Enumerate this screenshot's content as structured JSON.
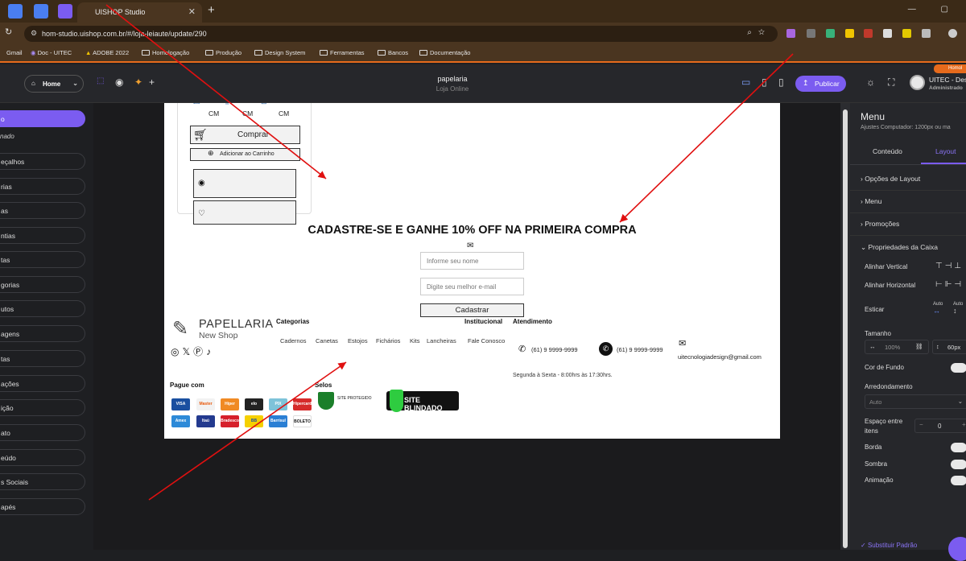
{
  "browser": {
    "tab_title": "UISHOP Studio",
    "tab_close": "✕",
    "new_tab": "+",
    "window_controls": "—  ▢",
    "url": "hom-studio.uishop.com.br/#/loja-leiaute/update/290",
    "bookmarks": [
      "Gmail",
      "Doc - UITEC",
      "ADOBE 2022",
      "Homologação",
      "Produção",
      "Design System",
      "Ferramentas",
      "Bancos",
      "Documentação"
    ]
  },
  "app_header": {
    "home_label": "Home",
    "project_name": "papelaria",
    "project_sub": "Loja Online",
    "publish_label": "Publicar",
    "user_name": "UITEC - Desi",
    "user_role": "Administrado",
    "env_tag": "Homol"
  },
  "sidebar": {
    "italic_label": "nado",
    "items": [
      "o",
      "eçalhos",
      "rias",
      "as",
      "ntias",
      "tas",
      "gorias",
      "utos",
      "agens",
      "tas",
      "ações",
      "ição",
      "ato",
      "eúdo",
      "s Sociais",
      "apés"
    ]
  },
  "page": {
    "sizes": [
      "CM",
      "CM",
      "CM"
    ],
    "buy_label": "Comprar",
    "add_cart_label": "Adicionar ao Carrinho",
    "newsletter_title": "CADASTRE-SE E GANHE 10% OFF NA PRIMEIRA COMPRA",
    "name_placeholder": "Informe seu nome",
    "email_placeholder": "Digite seu melhor e-mail",
    "submit_label": "Cadastrar",
    "logo_name": "PAPELLARIA",
    "logo_sub": "New Shop",
    "social_icons": "◎𝕏Ⓟ♪",
    "footer_categories_title": "Categorias",
    "footer_institutional_title": "Institucional",
    "footer_service_title": "Atendimento",
    "categories": [
      "Cadernos",
      "Canetas",
      "Estojos",
      "Fichários",
      "Kits",
      "Lancheiras",
      "Fale Conosco"
    ],
    "phone_1": "(61) 9 9999-9999",
    "phone_2": "(61) 9 9999-9999",
    "email": "uitecnologiadesign@gmail.com",
    "hours": "Segunda à Sexta - 8:00hrs às 17:30hrs.",
    "payment_title": "Pague com",
    "seals_title": "Selos",
    "payment_methods": [
      "VISA",
      "Master",
      "Hiper",
      "elo",
      "PIX",
      "Hipercard",
      "Amex",
      "Itaú",
      "Bradesco",
      "BB",
      "Barrisul",
      "BOLETO"
    ],
    "seal_protected": "SITE PROTEGIDO",
    "seal_blindado": "SITE BLINDADO"
  },
  "right_panel": {
    "title": "Menu",
    "subtitle": "Ajustes Computador: 1200px ou ma",
    "tab_content": "Conteúdo",
    "tab_layout": "Layout",
    "sections": [
      "Opções de Layout",
      "Menu",
      "Promoções",
      "Propriedades da Caixa"
    ],
    "align_vertical": "Alinhar Vertical",
    "align_horizontal": "Alinhar Horizontal",
    "stretch": "Esticar",
    "auto_1": "Auto",
    "auto_2": "Auto",
    "size_label": "Tamanho",
    "width_value": "100%",
    "height_value": "60px",
    "bg_color_label": "Cor de Fundo",
    "radius_label": "Arredondamento",
    "radius_value": "Auto",
    "gap_label": "Espaço entre itens",
    "gap_value": "0",
    "border_label": "Borda",
    "shadow_label": "Sombra",
    "animation_label": "Animação",
    "restore_label": "Substituir Padrão"
  },
  "colors": {
    "accent": "#7b5cf0",
    "chrome_brown": "#4a3520",
    "arrow_red": "#e01010",
    "env_orange": "#e66a1c"
  }
}
